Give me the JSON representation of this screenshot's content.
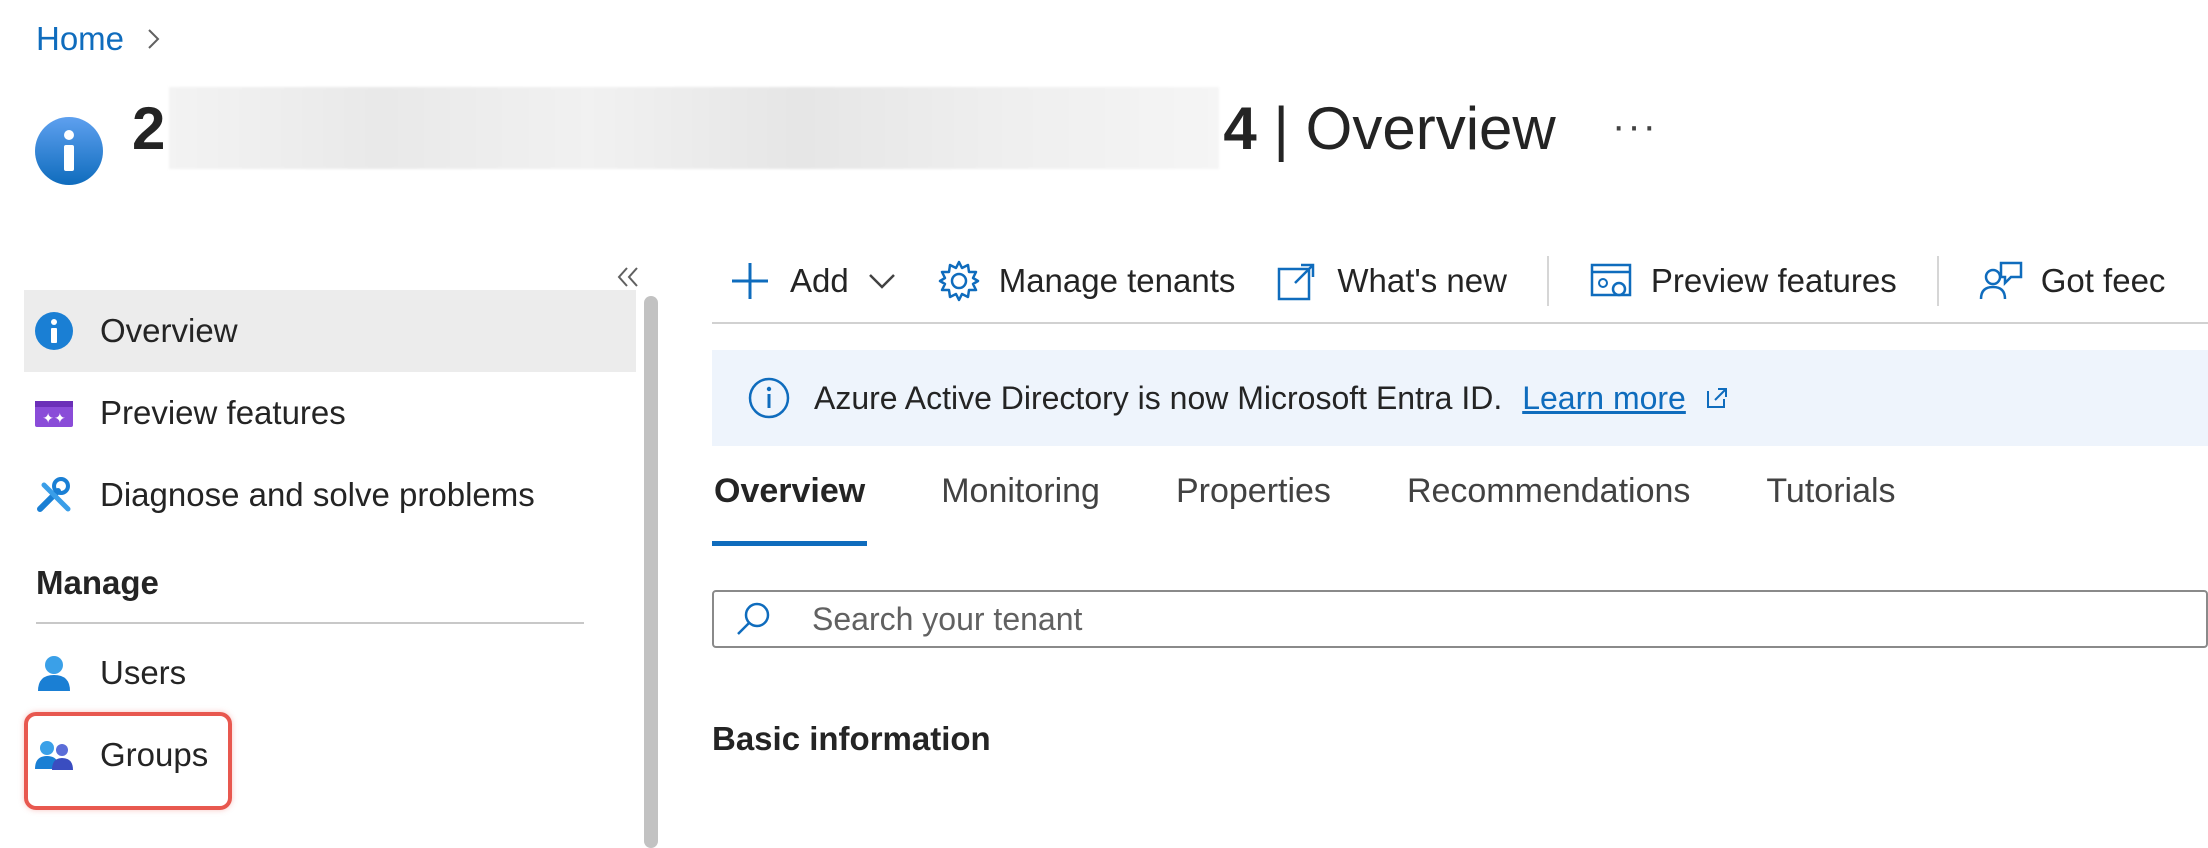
{
  "breadcrumb": {
    "home": "Home"
  },
  "header": {
    "title_prefix": "2",
    "title_suffix": "4 | Overview",
    "more": "···"
  },
  "sidebar": {
    "items": [
      {
        "label": "Overview",
        "icon": "info-icon"
      },
      {
        "label": "Preview features",
        "icon": "preview-features-icon"
      },
      {
        "label": "Diagnose and solve problems",
        "icon": "wrench-icon"
      }
    ],
    "section": "Manage",
    "manage_items": [
      {
        "label": "Users",
        "icon": "user-icon"
      },
      {
        "label": "Groups",
        "icon": "groups-icon"
      }
    ]
  },
  "toolbar": {
    "add": "Add",
    "manage_tenants": "Manage tenants",
    "whats_new": "What's new",
    "preview_features": "Preview features",
    "feedback": "Got feec"
  },
  "banner": {
    "text": "Azure Active Directory is now Microsoft Entra ID.",
    "link": "Learn more"
  },
  "tabs": [
    "Overview",
    "Monitoring",
    "Properties",
    "Recommendations",
    "Tutorials"
  ],
  "search": {
    "placeholder": "Search your tenant"
  },
  "basic_info": "Basic information",
  "colors": {
    "accent": "#0f6cbd",
    "highlight": "#e8584f"
  }
}
